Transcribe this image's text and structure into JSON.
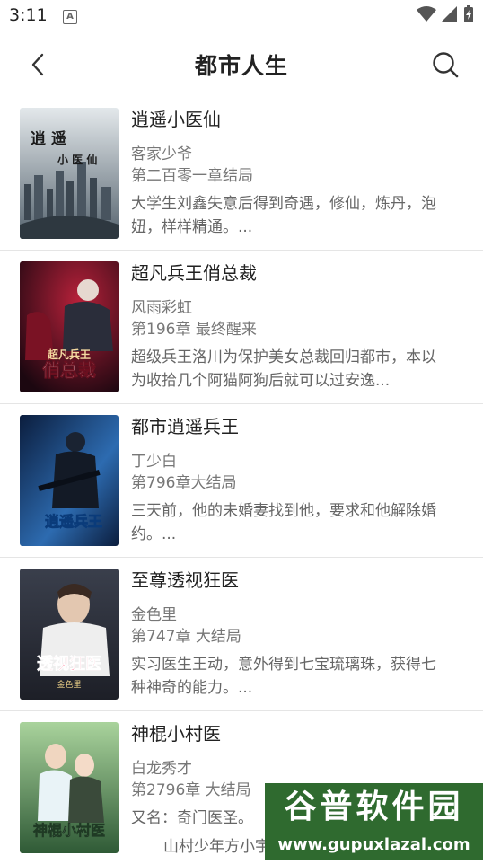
{
  "status": {
    "time": "3:11",
    "notification_letter": "A"
  },
  "header": {
    "title": "都市人生"
  },
  "books": [
    {
      "title": "逍遥小医仙",
      "author": "客家少爷",
      "chapter": "第二百零一章结局",
      "desc": "大学生刘鑫失意后得到奇遇，修仙，炼丹，泡妞，样样精通。...",
      "cover_text": "逍遥小医仙",
      "cover_colors": [
        "#cfd6da",
        "#5f6e78"
      ]
    },
    {
      "title": "超凡兵王俏总裁",
      "author": "风雨彩虹",
      "chapter": "第196章 最终醒来",
      "desc": "超级兵王洛川为保护美女总裁回归都市，本以为收拾几个阿猫阿狗后就可以过安逸...",
      "cover_text": "俏总裁",
      "cover_colors": [
        "#3a0f1a",
        "#b7213a"
      ]
    },
    {
      "title": "都市逍遥兵王",
      "author": "丁少白",
      "chapter": "第796章大结局",
      "desc": "三天前，他的未婚妻找到他，要求和他解除婚约。...",
      "cover_text": "逍遥兵王",
      "cover_colors": [
        "#0e2a55",
        "#2d6bb0"
      ]
    },
    {
      "title": "至尊透视狂医",
      "author": "金色里",
      "chapter": "第747章 大结局",
      "desc": "实习医生王动，意外得到七宝琉璃珠，获得七种神奇的能力。...",
      "cover_text": "透视狂医",
      "cover_colors": [
        "#2c2f3a",
        "#8a3a50"
      ]
    },
    {
      "title": "神棍小村医",
      "author": "白龙秀才",
      "chapter": "第2796章 大结局",
      "desc": "又名：奇门医圣。",
      "cover_text": "神棍小村医",
      "cover_colors": [
        "#7fb27a",
        "#2f5a36"
      ]
    }
  ],
  "watermark": {
    "main": "谷普软件园",
    "url": "www.gupuxlazal.com",
    "overlap_text": "山村少年方小宇"
  }
}
